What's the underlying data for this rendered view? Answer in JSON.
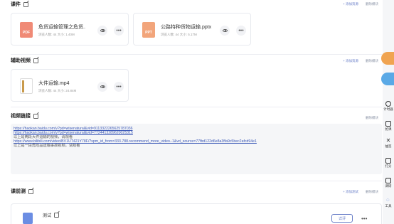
{
  "courseware": {
    "title": "课件",
    "add_label": "+ 添加资源",
    "delete_label": "删除模块",
    "files": [
      {
        "icon_text": "PDF",
        "name": "危货运输管理之危货...",
        "meta": "浏览人数: 44  大小: 1.40M"
      },
      {
        "icon_text": "PPT",
        "name": "公路特种货物运输.pptx",
        "meta": "浏览人数: 44  大小: 5.17M"
      }
    ]
  },
  "aux_video": {
    "title": "辅助视频",
    "add_label": "+ 添加资源",
    "delete_label": "删除模块",
    "files": [
      {
        "name": "大件运输.mp4",
        "meta": "浏览人数: 44  大小: 24.84M"
      }
    ]
  },
  "video_links": {
    "title": "视频链接",
    "delete_label": "删除模块",
    "lines": [
      {
        "type": "link",
        "text": "https://haokan.baidu.com/v?pd=wisenatural&vid=9113322265625787036"
      },
      {
        "type": "link",
        "text": "https://haokan.baidu.com/v?pd=wisenatural&vid=7724413289620025315"
      },
      {
        "type": "text",
        "text": "以上是两段大件运输的视频，请观看"
      },
      {
        "type": "link",
        "text": "https://www.bilibili.com/video/BV1UT421Y78F/?spm_id_from=333.788.recommend_more_video.-1&vd_source=77fbd122d6e8a3ffa9c5bec2afcd94e1"
      },
      {
        "type": "text",
        "text": "以上是一段危险品运输事故视频，请观看"
      }
    ]
  },
  "pre_test": {
    "title": "课前测",
    "add_label": "+ 添加测试",
    "delete_label": "删除模块",
    "item_name": "测试",
    "detail_label": "详评"
  },
  "more_label": "•••",
  "rail": {
    "items": [
      "计时器",
      "抢课",
      "抽签",
      "打分",
      "调研",
      "工具"
    ]
  },
  "colors": {
    "accent": "#6a7fc8",
    "link": "#3e5bb8",
    "pdf": "#f08a76",
    "ppt": "#f2a57b"
  }
}
